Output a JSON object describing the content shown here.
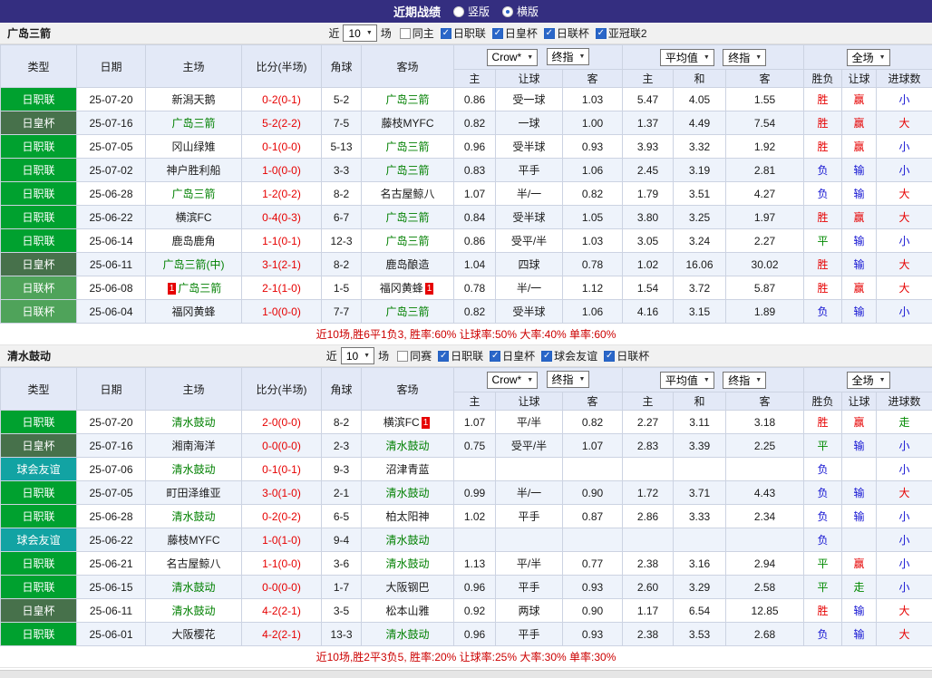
{
  "topbar": {
    "title": "近期战绩",
    "radios": [
      {
        "label": "竖版",
        "selected": false
      },
      {
        "label": "横版",
        "selected": true
      }
    ]
  },
  "colors": {
    "focus_team": "#008000",
    "score": "#e60000",
    "league": {
      "日职联": "#00a12f",
      "日皇杯": "#47714b",
      "日联杯": "#4fa35a",
      "球会友谊": "#12a3a3"
    },
    "marks": {
      "胜": "#e60000",
      "平": "#008900",
      "负": "#1414d2",
      "赢": "#e60000",
      "输": "#1414d2",
      "走": "#008900",
      "大": "#e60000",
      "小": "#1414d2"
    }
  },
  "sections": [
    {
      "team": "广岛三箭",
      "filter": {
        "prefix": "近",
        "count": "10",
        "suffix": "场",
        "checks": [
          {
            "label": "同主",
            "checked": false
          },
          {
            "label": "日职联",
            "checked": true
          },
          {
            "label": "日皇杯",
            "checked": true
          },
          {
            "label": "日联杯",
            "checked": true
          },
          {
            "label": "亚冠联2",
            "checked": true
          }
        ]
      },
      "header": {
        "cols": [
          "类型",
          "日期",
          "主场",
          "比分(半场)",
          "角球",
          "客场"
        ],
        "odds_selects": [
          "Crow*",
          "终指"
        ],
        "avg_selects": [
          "平均值",
          "终指"
        ],
        "scope_select": "全场",
        "sub": [
          "主",
          "让球",
          "客",
          "主",
          "和",
          "客",
          "胜负",
          "让球",
          "进球数"
        ]
      },
      "rows": [
        {
          "league": "日职联",
          "date": "25-07-20",
          "home": "新潟天鹅",
          "home_focus": false,
          "home_badge": "",
          "score": "0-2(0-1)",
          "corner": "5-2",
          "away": "广岛三箭",
          "away_focus": true,
          "away_badge": "",
          "odds": [
            "0.86",
            "受一球",
            "1.03"
          ],
          "avg": [
            "5.47",
            "4.05",
            "1.55"
          ],
          "res": "胜",
          "han": "赢",
          "goal": "小"
        },
        {
          "league": "日皇杯",
          "date": "25-07-16",
          "home": "广岛三箭",
          "home_focus": true,
          "home_badge": "",
          "score": "5-2(2-2)",
          "corner": "7-5",
          "away": "藤枝MYFC",
          "away_focus": false,
          "away_badge": "",
          "odds": [
            "0.82",
            "一球",
            "1.00"
          ],
          "avg": [
            "1.37",
            "4.49",
            "7.54"
          ],
          "res": "胜",
          "han": "赢",
          "goal": "大"
        },
        {
          "league": "日职联",
          "date": "25-07-05",
          "home": "冈山绿雉",
          "home_focus": false,
          "home_badge": "",
          "score": "0-1(0-0)",
          "corner": "5-13",
          "away": "广岛三箭",
          "away_focus": true,
          "away_badge": "",
          "odds": [
            "0.96",
            "受半球",
            "0.93"
          ],
          "avg": [
            "3.93",
            "3.32",
            "1.92"
          ],
          "res": "胜",
          "han": "赢",
          "goal": "小"
        },
        {
          "league": "日职联",
          "date": "25-07-02",
          "home": "神户胜利船",
          "home_focus": false,
          "home_badge": "",
          "score": "1-0(0-0)",
          "corner": "3-3",
          "away": "广岛三箭",
          "away_focus": true,
          "away_badge": "",
          "odds": [
            "0.83",
            "平手",
            "1.06"
          ],
          "avg": [
            "2.45",
            "3.19",
            "2.81"
          ],
          "res": "负",
          "han": "输",
          "goal": "小"
        },
        {
          "league": "日职联",
          "date": "25-06-28",
          "home": "广岛三箭",
          "home_focus": true,
          "home_badge": "",
          "score": "1-2(0-2)",
          "corner": "8-2",
          "away": "名古屋鲸八",
          "away_focus": false,
          "away_badge": "",
          "odds": [
            "1.07",
            "半/一",
            "0.82"
          ],
          "avg": [
            "1.79",
            "3.51",
            "4.27"
          ],
          "res": "负",
          "han": "输",
          "goal": "大"
        },
        {
          "league": "日职联",
          "date": "25-06-22",
          "home": "横滨FC",
          "home_focus": false,
          "home_badge": "",
          "score": "0-4(0-3)",
          "corner": "6-7",
          "away": "广岛三箭",
          "away_focus": true,
          "away_badge": "",
          "odds": [
            "0.84",
            "受半球",
            "1.05"
          ],
          "avg": [
            "3.80",
            "3.25",
            "1.97"
          ],
          "res": "胜",
          "han": "赢",
          "goal": "大"
        },
        {
          "league": "日职联",
          "date": "25-06-14",
          "home": "鹿岛鹿角",
          "home_focus": false,
          "home_badge": "",
          "score": "1-1(0-1)",
          "corner": "12-3",
          "away": "广岛三箭",
          "away_focus": true,
          "away_badge": "",
          "odds": [
            "0.86",
            "受平/半",
            "1.03"
          ],
          "avg": [
            "3.05",
            "3.24",
            "2.27"
          ],
          "res": "平",
          "han": "输",
          "goal": "小"
        },
        {
          "league": "日皇杯",
          "date": "25-06-11",
          "home": "广岛三箭(中)",
          "home_focus": true,
          "home_badge": "",
          "score": "3-1(2-1)",
          "corner": "8-2",
          "away": "鹿岛酿造",
          "away_focus": false,
          "away_badge": "",
          "odds": [
            "1.04",
            "四球",
            "0.78"
          ],
          "avg": [
            "1.02",
            "16.06",
            "30.02"
          ],
          "res": "胜",
          "han": "输",
          "goal": "大"
        },
        {
          "league": "日联杯",
          "date": "25-06-08",
          "home": "广岛三箭",
          "home_focus": true,
          "home_badge": "1",
          "score": "2-1(1-0)",
          "corner": "1-5",
          "away": "福冈黄蜂",
          "away_focus": false,
          "away_badge": "1",
          "odds": [
            "0.78",
            "半/一",
            "1.12"
          ],
          "avg": [
            "1.54",
            "3.72",
            "5.87"
          ],
          "res": "胜",
          "han": "赢",
          "goal": "大"
        },
        {
          "league": "日联杯",
          "date": "25-06-04",
          "home": "福冈黄蜂",
          "home_focus": false,
          "home_badge": "",
          "score": "1-0(0-0)",
          "corner": "7-7",
          "away": "广岛三箭",
          "away_focus": true,
          "away_badge": "",
          "odds": [
            "0.82",
            "受半球",
            "1.06"
          ],
          "avg": [
            "4.16",
            "3.15",
            "1.89"
          ],
          "res": "负",
          "han": "输",
          "goal": "小"
        }
      ],
      "summary": "近10场,胜6平1负3, 胜率:60% 让球率:50% 大率:40% 单率:60%"
    },
    {
      "team": "清水鼓动",
      "filter": {
        "prefix": "近",
        "count": "10",
        "suffix": "场",
        "checks": [
          {
            "label": "同赛",
            "checked": false
          },
          {
            "label": "日职联",
            "checked": true
          },
          {
            "label": "日皇杯",
            "checked": true
          },
          {
            "label": "球会友谊",
            "checked": true
          },
          {
            "label": "日联杯",
            "checked": true
          }
        ]
      },
      "header": {
        "cols": [
          "类型",
          "日期",
          "主场",
          "比分(半场)",
          "角球",
          "客场"
        ],
        "odds_selects": [
          "Crow*",
          "终指"
        ],
        "avg_selects": [
          "平均值",
          "终指"
        ],
        "scope_select": "全场",
        "sub": [
          "主",
          "让球",
          "客",
          "主",
          "和",
          "客",
          "胜负",
          "让球",
          "进球数"
        ]
      },
      "rows": [
        {
          "league": "日职联",
          "date": "25-07-20",
          "home": "清水鼓动",
          "home_focus": true,
          "home_badge": "",
          "score": "2-0(0-0)",
          "corner": "8-2",
          "away": "横滨FC",
          "away_focus": false,
          "away_badge": "1",
          "odds": [
            "1.07",
            "平/半",
            "0.82"
          ],
          "avg": [
            "2.27",
            "3.11",
            "3.18"
          ],
          "res": "胜",
          "han": "赢",
          "goal": "走"
        },
        {
          "league": "日皇杯",
          "date": "25-07-16",
          "home": "湘南海洋",
          "home_focus": false,
          "home_badge": "",
          "score": "0-0(0-0)",
          "corner": "2-3",
          "away": "清水鼓动",
          "away_focus": true,
          "away_badge": "",
          "odds": [
            "0.75",
            "受平/半",
            "1.07"
          ],
          "avg": [
            "2.83",
            "3.39",
            "2.25"
          ],
          "res": "平",
          "han": "输",
          "goal": "小"
        },
        {
          "league": "球会友谊",
          "date": "25-07-06",
          "home": "清水鼓动",
          "home_focus": true,
          "home_badge": "",
          "score": "0-1(0-1)",
          "corner": "9-3",
          "away": "沼津青蓝",
          "away_focus": false,
          "away_badge": "",
          "odds": [
            "",
            "",
            ""
          ],
          "avg": [
            "",
            "",
            ""
          ],
          "res": "负",
          "han": "",
          "goal": "小"
        },
        {
          "league": "日职联",
          "date": "25-07-05",
          "home": "町田泽维亚",
          "home_focus": false,
          "home_badge": "",
          "score": "3-0(1-0)",
          "corner": "2-1",
          "away": "清水鼓动",
          "away_focus": true,
          "away_badge": "",
          "odds": [
            "0.99",
            "半/一",
            "0.90"
          ],
          "avg": [
            "1.72",
            "3.71",
            "4.43"
          ],
          "res": "负",
          "han": "输",
          "goal": "大"
        },
        {
          "league": "日职联",
          "date": "25-06-28",
          "home": "清水鼓动",
          "home_focus": true,
          "home_badge": "",
          "score": "0-2(0-2)",
          "corner": "6-5",
          "away": "柏太阳神",
          "away_focus": false,
          "away_badge": "",
          "odds": [
            "1.02",
            "平手",
            "0.87"
          ],
          "avg": [
            "2.86",
            "3.33",
            "2.34"
          ],
          "res": "负",
          "han": "输",
          "goal": "小"
        },
        {
          "league": "球会友谊",
          "date": "25-06-22",
          "home": "藤枝MYFC",
          "home_focus": false,
          "home_badge": "",
          "score": "1-0(1-0)",
          "corner": "9-4",
          "away": "清水鼓动",
          "away_focus": true,
          "away_badge": "",
          "odds": [
            "",
            "",
            ""
          ],
          "avg": [
            "",
            "",
            ""
          ],
          "res": "负",
          "han": "",
          "goal": "小"
        },
        {
          "league": "日职联",
          "date": "25-06-21",
          "home": "名古屋鲸八",
          "home_focus": false,
          "home_badge": "",
          "score": "1-1(0-0)",
          "corner": "3-6",
          "away": "清水鼓动",
          "away_focus": true,
          "away_badge": "",
          "odds": [
            "1.13",
            "平/半",
            "0.77"
          ],
          "avg": [
            "2.38",
            "3.16",
            "2.94"
          ],
          "res": "平",
          "han": "赢",
          "goal": "小"
        },
        {
          "league": "日职联",
          "date": "25-06-15",
          "home": "清水鼓动",
          "home_focus": true,
          "home_badge": "",
          "score": "0-0(0-0)",
          "corner": "1-7",
          "away": "大阪钢巴",
          "away_focus": false,
          "away_badge": "",
          "odds": [
            "0.96",
            "平手",
            "0.93"
          ],
          "avg": [
            "2.60",
            "3.29",
            "2.58"
          ],
          "res": "平",
          "han": "走",
          "goal": "小"
        },
        {
          "league": "日皇杯",
          "date": "25-06-11",
          "home": "清水鼓动",
          "home_focus": true,
          "home_badge": "",
          "score": "4-2(2-1)",
          "corner": "3-5",
          "away": "松本山雅",
          "away_focus": false,
          "away_badge": "",
          "odds": [
            "0.92",
            "两球",
            "0.90"
          ],
          "avg": [
            "1.17",
            "6.54",
            "12.85"
          ],
          "res": "胜",
          "han": "输",
          "goal": "大"
        },
        {
          "league": "日职联",
          "date": "25-06-01",
          "home": "大阪樱花",
          "home_focus": false,
          "home_badge": "",
          "score": "4-2(2-1)",
          "corner": "13-3",
          "away": "清水鼓动",
          "away_focus": true,
          "away_badge": "",
          "odds": [
            "0.96",
            "平手",
            "0.93"
          ],
          "avg": [
            "2.38",
            "3.53",
            "2.68"
          ],
          "res": "负",
          "han": "输",
          "goal": "大"
        }
      ],
      "summary": "近10场,胜2平3负5, 胜率:20% 让球率:25% 大率:30% 单率:30%"
    }
  ]
}
